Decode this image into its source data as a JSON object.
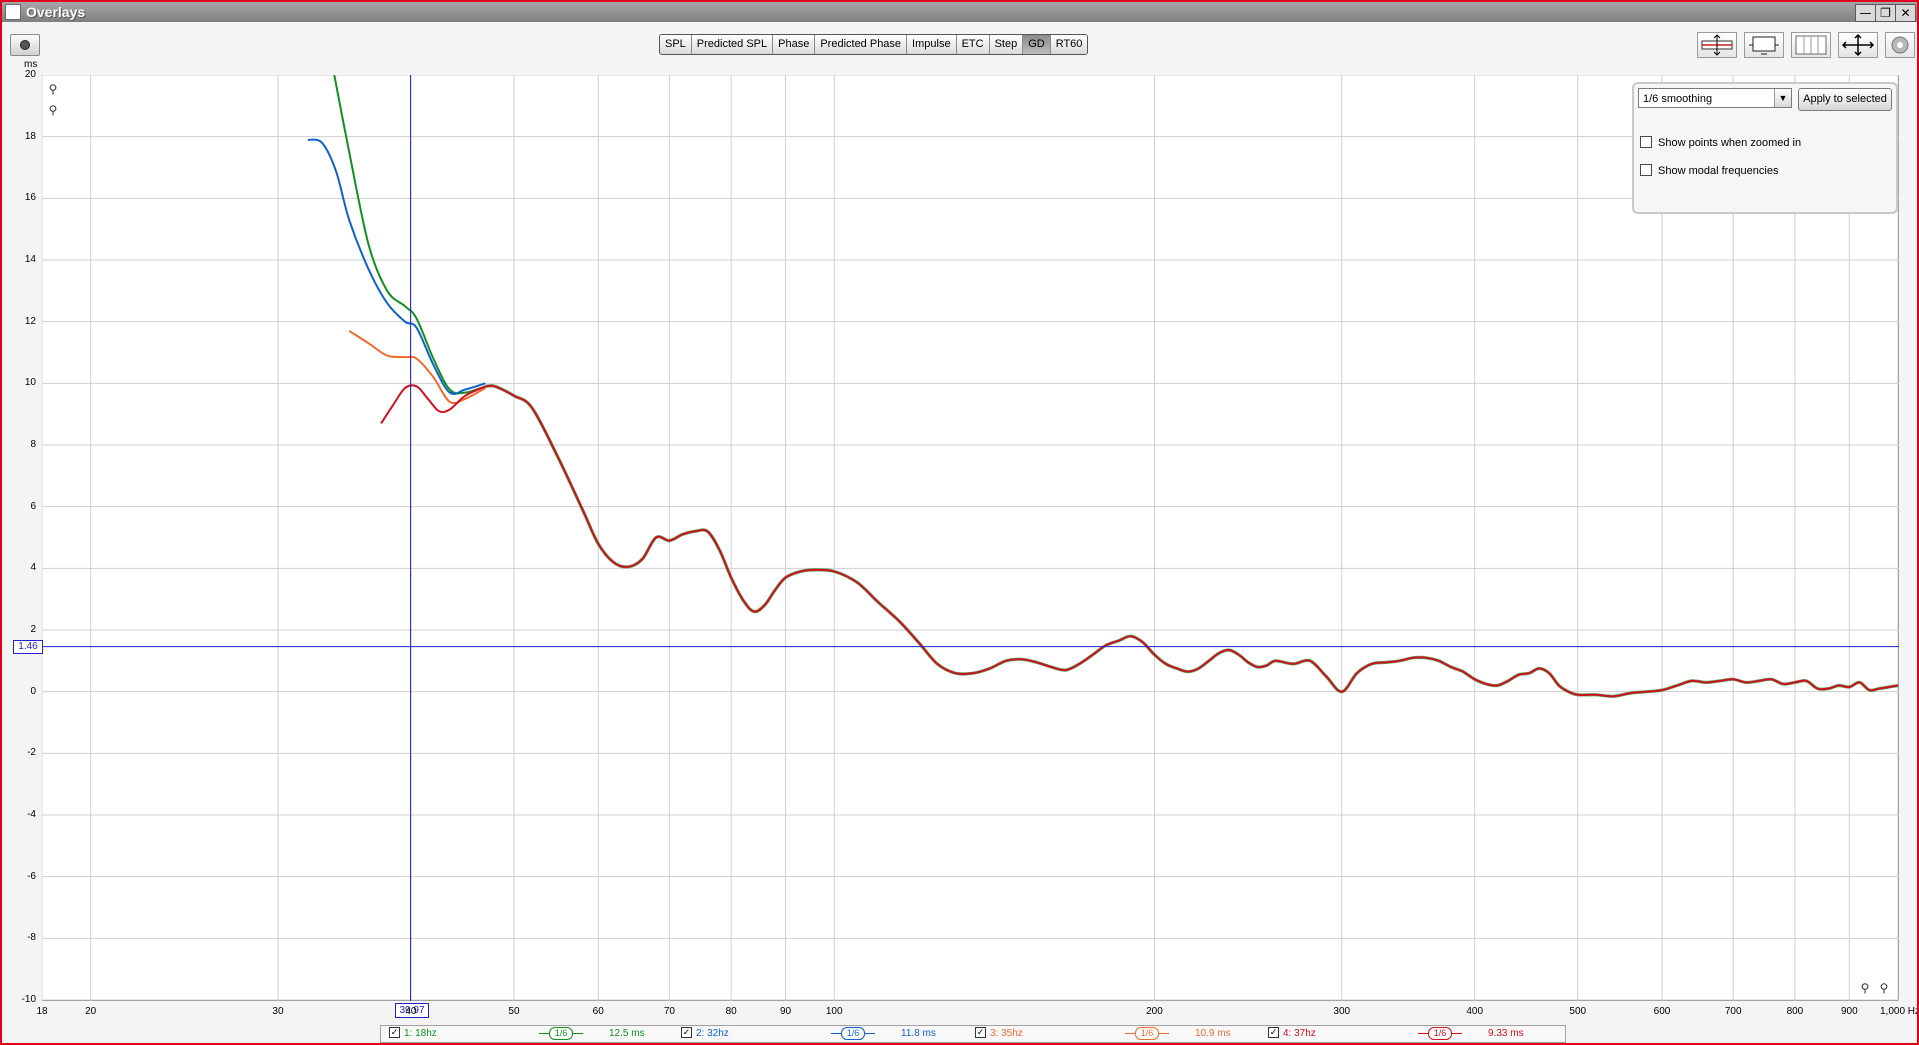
{
  "window": {
    "title": "Overlays",
    "buttons": {
      "minimize": "—",
      "maximize": "❐",
      "close": "✕"
    }
  },
  "toolbar": {
    "tabs": [
      {
        "label": "SPL",
        "active": false
      },
      {
        "label": "Predicted SPL",
        "active": false
      },
      {
        "label": "Phase",
        "active": false
      },
      {
        "label": "Predicted Phase",
        "active": false
      },
      {
        "label": "Impulse",
        "active": false
      },
      {
        "label": "ETC",
        "active": false
      },
      {
        "label": "Step",
        "active": false
      },
      {
        "label": "GD",
        "active": true
      },
      {
        "label": "RT60",
        "active": false
      }
    ]
  },
  "controls": {
    "smoothing_value": "1/6 smoothing",
    "apply_label": "Apply to selected",
    "show_points_label": "Show points when zoomed in",
    "show_points_checked": false,
    "show_modal_label": "Show modal frequencies",
    "show_modal_checked": false
  },
  "cursor": {
    "x_label": "39.97",
    "y_label": "1.46",
    "x": 39.97,
    "y": 1.46,
    "color": "#2222cc"
  },
  "legend": [
    {
      "label": "1: 18hz",
      "smoothing": "1/6",
      "value": "12.5 ms",
      "color": "#109020",
      "checked": true
    },
    {
      "label": "2: 32hz",
      "smoothing": "1/6",
      "value": "11.8 ms",
      "color": "#1060d0",
      "checked": true
    },
    {
      "label": "3: 35hz",
      "smoothing": "1/6",
      "value": "10.9 ms",
      "color": "#f06a30",
      "checked": true
    },
    {
      "label": "4: 37hz",
      "smoothing": "1/6",
      "value": "9.33 ms",
      "color": "#d01020",
      "checked": true
    }
  ],
  "chart_data": {
    "type": "line",
    "xscale": "log",
    "xlim": [
      18,
      1000
    ],
    "ylim": [
      -10,
      20
    ],
    "yunit": "ms",
    "xunit": "Hz",
    "xticks": [
      {
        "v": 18,
        "l": "18"
      },
      {
        "v": 20,
        "l": "20"
      },
      {
        "v": 30,
        "l": "30"
      },
      {
        "v": 40,
        "l": "40"
      },
      {
        "v": 50,
        "l": "50"
      },
      {
        "v": 60,
        "l": "60"
      },
      {
        "v": 70,
        "l": "70"
      },
      {
        "v": 80,
        "l": "80"
      },
      {
        "v": 90,
        "l": "90"
      },
      {
        "v": 100,
        "l": "100"
      },
      {
        "v": 200,
        "l": "200"
      },
      {
        "v": 300,
        "l": "300"
      },
      {
        "v": 400,
        "l": "400"
      },
      {
        "v": 500,
        "l": "500"
      },
      {
        "v": 600,
        "l": "600"
      },
      {
        "v": 700,
        "l": "700"
      },
      {
        "v": 800,
        "l": "800"
      },
      {
        "v": 900,
        "l": "900"
      },
      {
        "v": 1000,
        "l": "1,000 Hz"
      }
    ],
    "yticks": [
      20,
      18,
      16,
      14,
      12,
      10,
      8,
      6,
      4,
      2,
      0,
      -2,
      -4,
      -6,
      -8,
      -10
    ],
    "grid": true,
    "background": "#ffffff",
    "series": [
      {
        "name": "1: 18hz",
        "color": "#109020",
        "x": [
          33.8,
          35,
          36.5,
          38,
          39.5,
          40.5,
          42,
          43.5,
          45,
          47
        ],
        "y": [
          20.2,
          17.5,
          14.5,
          13.0,
          12.5,
          12.1,
          10.8,
          9.8,
          9.7,
          9.9
        ]
      },
      {
        "name": "2: 32hz",
        "color": "#1060d0",
        "x": [
          32,
          33,
          34,
          35,
          36.5,
          38,
          39.5,
          40.5,
          42,
          43.5,
          45,
          47
        ],
        "y": [
          17.9,
          17.8,
          16.9,
          15.3,
          13.7,
          12.6,
          12.0,
          11.8,
          10.6,
          9.7,
          9.8,
          10.0
        ]
      },
      {
        "name": "3: 35hz",
        "color": "#f06a30",
        "x": [
          35,
          36.5,
          38,
          39.5,
          40.5,
          42,
          43.5,
          45,
          47
        ],
        "y": [
          11.7,
          11.3,
          10.9,
          10.85,
          10.8,
          10.2,
          9.4,
          9.5,
          9.85
        ]
      },
      {
        "name": "4: 37hz",
        "color": "#d01020",
        "x": [
          37.5,
          38.5,
          39.5,
          40.5,
          41.5,
          42.5,
          43.5,
          45,
          47
        ],
        "y": [
          8.7,
          9.3,
          9.85,
          9.9,
          9.5,
          9.1,
          9.15,
          9.6,
          9.9
        ]
      },
      {
        "name": "common",
        "color": "#d01020",
        "x": [
          47,
          48,
          50,
          52,
          55,
          58,
          60,
          62,
          64,
          66,
          68,
          70,
          72,
          74,
          76,
          78,
          80,
          82,
          84,
          86,
          88,
          90,
          93,
          96,
          100,
          105,
          110,
          115,
          120,
          125,
          130,
          135,
          140,
          145,
          150,
          155,
          160,
          165,
          170,
          175,
          180,
          185,
          190,
          195,
          200,
          205,
          210,
          215,
          220,
          225,
          230,
          235,
          240,
          245,
          250,
          255,
          260,
          270,
          280,
          290,
          300,
          310,
          320,
          330,
          340,
          350,
          360,
          370,
          380,
          390,
          400,
          410,
          420,
          430,
          440,
          450,
          460,
          470,
          480,
          490,
          500,
          520,
          540,
          560,
          580,
          600,
          620,
          640,
          660,
          680,
          700,
          720,
          740,
          760,
          780,
          800,
          820,
          840,
          860,
          880,
          900,
          920,
          940,
          960,
          980,
          1000
        ],
        "y": [
          9.9,
          9.9,
          9.6,
          9.2,
          7.6,
          5.9,
          4.8,
          4.2,
          4.05,
          4.3,
          5.0,
          4.9,
          5.1,
          5.2,
          5.2,
          4.6,
          3.7,
          3.0,
          2.6,
          2.8,
          3.3,
          3.7,
          3.9,
          3.95,
          3.9,
          3.55,
          2.9,
          2.3,
          1.6,
          0.9,
          0.6,
          0.6,
          0.75,
          1.0,
          1.05,
          0.95,
          0.8,
          0.7,
          0.9,
          1.2,
          1.5,
          1.65,
          1.8,
          1.6,
          1.2,
          0.9,
          0.75,
          0.65,
          0.75,
          1.0,
          1.25,
          1.35,
          1.2,
          0.95,
          0.8,
          0.85,
          1.0,
          0.9,
          1.0,
          0.5,
          0.0,
          0.6,
          0.9,
          0.95,
          1.0,
          1.1,
          1.1,
          1.0,
          0.8,
          0.65,
          0.4,
          0.25,
          0.2,
          0.35,
          0.55,
          0.6,
          0.75,
          0.6,
          0.2,
          0.0,
          -0.1,
          -0.1,
          -0.15,
          -0.05,
          0.0,
          0.05,
          0.2,
          0.35,
          0.3,
          0.35,
          0.4,
          0.3,
          0.35,
          0.4,
          0.25,
          0.3,
          0.35,
          0.1,
          0.1,
          0.2,
          0.15,
          0.3,
          0.05,
          0.1,
          0.15,
          0.2
        ]
      }
    ]
  }
}
